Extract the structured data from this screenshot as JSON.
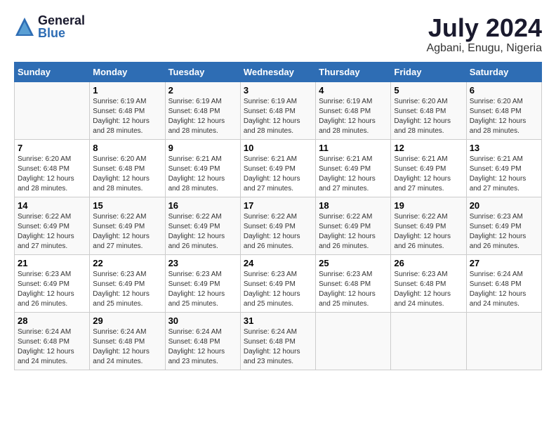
{
  "header": {
    "logo_general": "General",
    "logo_blue": "Blue",
    "month": "July 2024",
    "location": "Agbani, Enugu, Nigeria"
  },
  "days_of_week": [
    "Sunday",
    "Monday",
    "Tuesday",
    "Wednesday",
    "Thursday",
    "Friday",
    "Saturday"
  ],
  "weeks": [
    [
      {
        "day": "",
        "info": ""
      },
      {
        "day": "1",
        "info": "Sunrise: 6:19 AM\nSunset: 6:48 PM\nDaylight: 12 hours\nand 28 minutes."
      },
      {
        "day": "2",
        "info": "Sunrise: 6:19 AM\nSunset: 6:48 PM\nDaylight: 12 hours\nand 28 minutes."
      },
      {
        "day": "3",
        "info": "Sunrise: 6:19 AM\nSunset: 6:48 PM\nDaylight: 12 hours\nand 28 minutes."
      },
      {
        "day": "4",
        "info": "Sunrise: 6:19 AM\nSunset: 6:48 PM\nDaylight: 12 hours\nand 28 minutes."
      },
      {
        "day": "5",
        "info": "Sunrise: 6:20 AM\nSunset: 6:48 PM\nDaylight: 12 hours\nand 28 minutes."
      },
      {
        "day": "6",
        "info": "Sunrise: 6:20 AM\nSunset: 6:48 PM\nDaylight: 12 hours\nand 28 minutes."
      }
    ],
    [
      {
        "day": "7",
        "info": "Sunrise: 6:20 AM\nSunset: 6:48 PM\nDaylight: 12 hours\nand 28 minutes."
      },
      {
        "day": "8",
        "info": "Sunrise: 6:20 AM\nSunset: 6:48 PM\nDaylight: 12 hours\nand 28 minutes."
      },
      {
        "day": "9",
        "info": "Sunrise: 6:21 AM\nSunset: 6:49 PM\nDaylight: 12 hours\nand 28 minutes."
      },
      {
        "day": "10",
        "info": "Sunrise: 6:21 AM\nSunset: 6:49 PM\nDaylight: 12 hours\nand 27 minutes."
      },
      {
        "day": "11",
        "info": "Sunrise: 6:21 AM\nSunset: 6:49 PM\nDaylight: 12 hours\nand 27 minutes."
      },
      {
        "day": "12",
        "info": "Sunrise: 6:21 AM\nSunset: 6:49 PM\nDaylight: 12 hours\nand 27 minutes."
      },
      {
        "day": "13",
        "info": "Sunrise: 6:21 AM\nSunset: 6:49 PM\nDaylight: 12 hours\nand 27 minutes."
      }
    ],
    [
      {
        "day": "14",
        "info": "Sunrise: 6:22 AM\nSunset: 6:49 PM\nDaylight: 12 hours\nand 27 minutes."
      },
      {
        "day": "15",
        "info": "Sunrise: 6:22 AM\nSunset: 6:49 PM\nDaylight: 12 hours\nand 27 minutes."
      },
      {
        "day": "16",
        "info": "Sunrise: 6:22 AM\nSunset: 6:49 PM\nDaylight: 12 hours\nand 26 minutes."
      },
      {
        "day": "17",
        "info": "Sunrise: 6:22 AM\nSunset: 6:49 PM\nDaylight: 12 hours\nand 26 minutes."
      },
      {
        "day": "18",
        "info": "Sunrise: 6:22 AM\nSunset: 6:49 PM\nDaylight: 12 hours\nand 26 minutes."
      },
      {
        "day": "19",
        "info": "Sunrise: 6:22 AM\nSunset: 6:49 PM\nDaylight: 12 hours\nand 26 minutes."
      },
      {
        "day": "20",
        "info": "Sunrise: 6:23 AM\nSunset: 6:49 PM\nDaylight: 12 hours\nand 26 minutes."
      }
    ],
    [
      {
        "day": "21",
        "info": "Sunrise: 6:23 AM\nSunset: 6:49 PM\nDaylight: 12 hours\nand 26 minutes."
      },
      {
        "day": "22",
        "info": "Sunrise: 6:23 AM\nSunset: 6:49 PM\nDaylight: 12 hours\nand 25 minutes."
      },
      {
        "day": "23",
        "info": "Sunrise: 6:23 AM\nSunset: 6:49 PM\nDaylight: 12 hours\nand 25 minutes."
      },
      {
        "day": "24",
        "info": "Sunrise: 6:23 AM\nSunset: 6:49 PM\nDaylight: 12 hours\nand 25 minutes."
      },
      {
        "day": "25",
        "info": "Sunrise: 6:23 AM\nSunset: 6:48 PM\nDaylight: 12 hours\nand 25 minutes."
      },
      {
        "day": "26",
        "info": "Sunrise: 6:23 AM\nSunset: 6:48 PM\nDaylight: 12 hours\nand 24 minutes."
      },
      {
        "day": "27",
        "info": "Sunrise: 6:24 AM\nSunset: 6:48 PM\nDaylight: 12 hours\nand 24 minutes."
      }
    ],
    [
      {
        "day": "28",
        "info": "Sunrise: 6:24 AM\nSunset: 6:48 PM\nDaylight: 12 hours\nand 24 minutes."
      },
      {
        "day": "29",
        "info": "Sunrise: 6:24 AM\nSunset: 6:48 PM\nDaylight: 12 hours\nand 24 minutes."
      },
      {
        "day": "30",
        "info": "Sunrise: 6:24 AM\nSunset: 6:48 PM\nDaylight: 12 hours\nand 23 minutes."
      },
      {
        "day": "31",
        "info": "Sunrise: 6:24 AM\nSunset: 6:48 PM\nDaylight: 12 hours\nand 23 minutes."
      },
      {
        "day": "",
        "info": ""
      },
      {
        "day": "",
        "info": ""
      },
      {
        "day": "",
        "info": ""
      }
    ]
  ]
}
